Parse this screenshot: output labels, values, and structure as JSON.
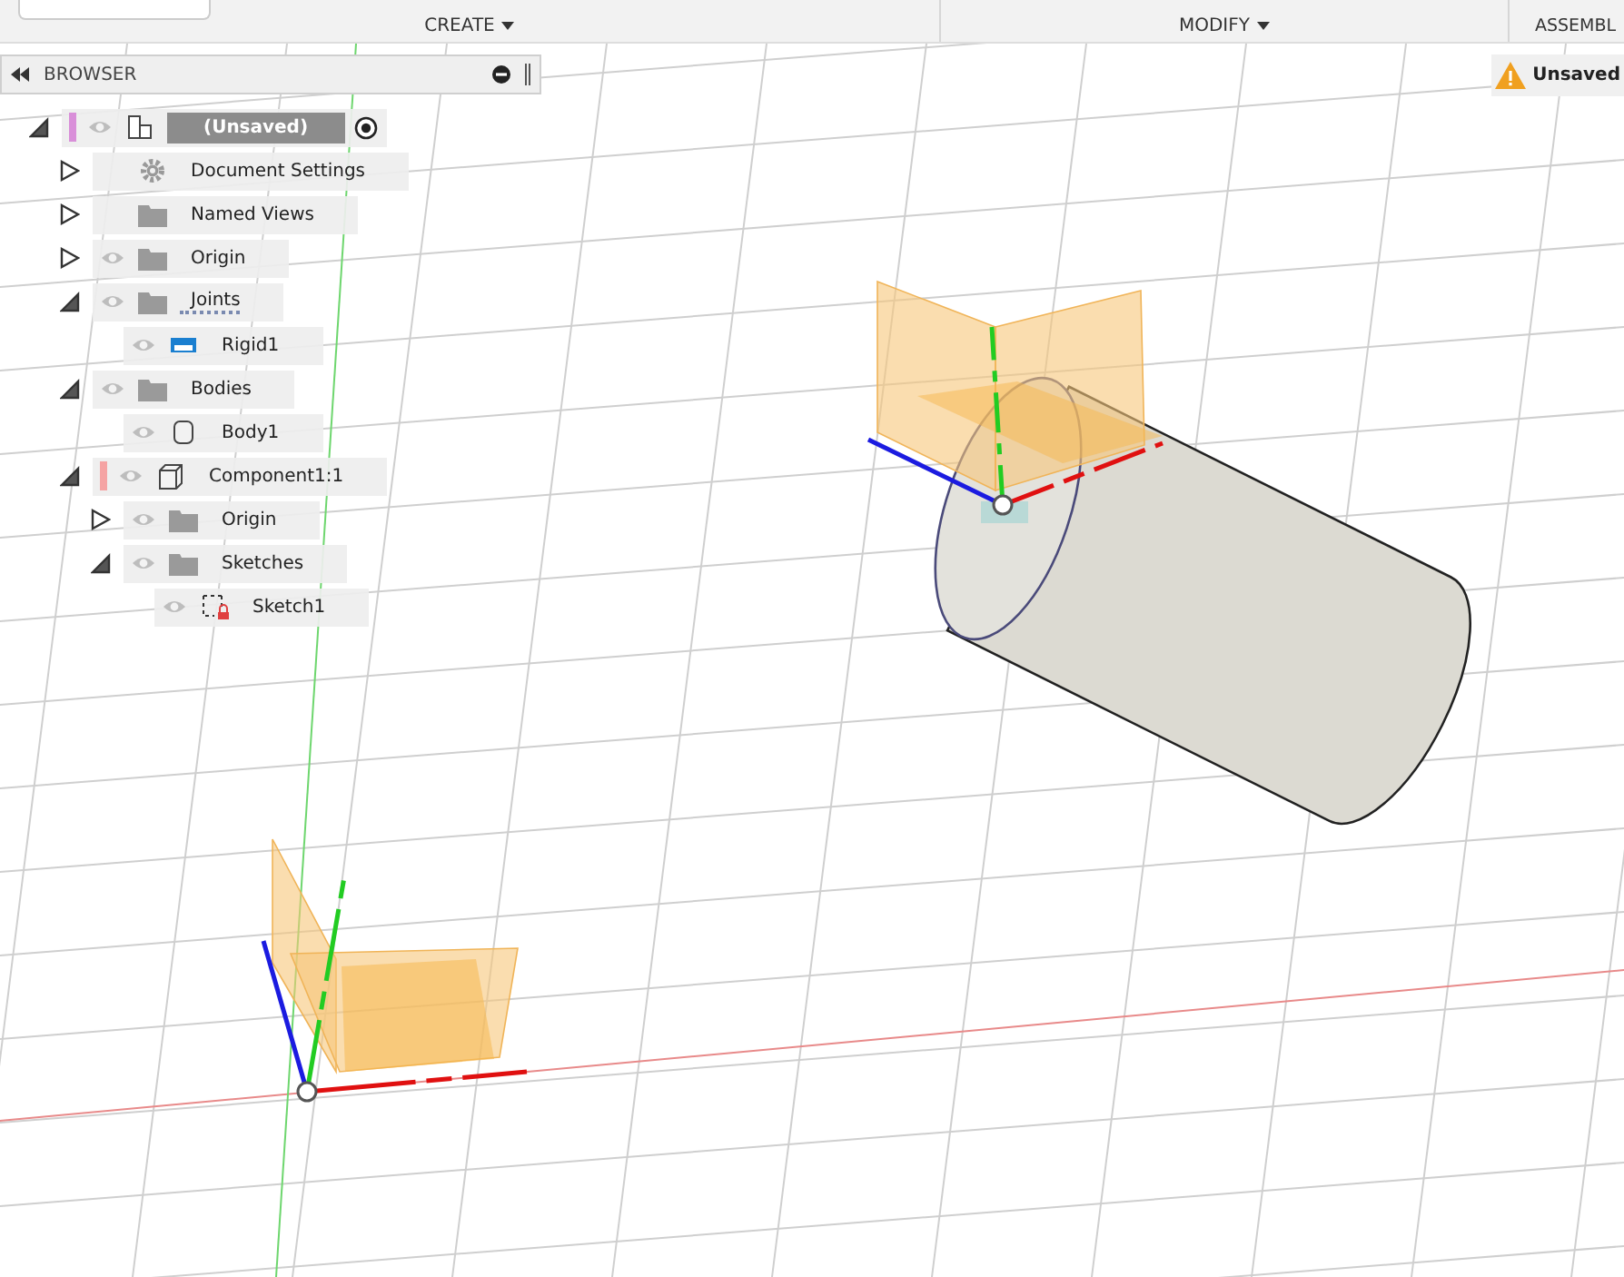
{
  "toolbar": {
    "groups": [
      {
        "label": "CREATE",
        "caret": true
      },
      {
        "label": "MODIFY",
        "caret": true
      },
      {
        "label": "ASSEMBL",
        "caret": false
      }
    ]
  },
  "warning": {
    "text": "Unsaved"
  },
  "browser": {
    "title": "BROWSER",
    "tree": [
      {
        "label": "(Unsaved)",
        "kind": "component",
        "eye": true,
        "expanded": true,
        "selected": true,
        "color": "#d98fd9",
        "active": true,
        "children": [
          {
            "label": "Document Settings",
            "kind": "settings",
            "eye": false,
            "expanded": false,
            "selected": false
          },
          {
            "label": "Named Views",
            "kind": "folder",
            "eye": false,
            "expanded": false,
            "selected": false
          },
          {
            "label": "Origin",
            "kind": "folder",
            "eye": true,
            "expanded": false,
            "selected": false
          },
          {
            "label": "Joints",
            "kind": "folder",
            "eye": true,
            "expanded": true,
            "selected": false,
            "children": [
              {
                "label": "Rigid1",
                "kind": "joint",
                "eye": true,
                "selected": false
              }
            ]
          },
          {
            "label": "Bodies",
            "kind": "folder",
            "eye": true,
            "expanded": true,
            "selected": false,
            "children": [
              {
                "label": "Body1",
                "kind": "body",
                "eye": true,
                "selected": false
              }
            ]
          },
          {
            "label": "Component1:1",
            "kind": "occurrence",
            "eye": true,
            "expanded": true,
            "selected": false,
            "color": "#f5a3a3",
            "children": [
              {
                "label": "Origin",
                "kind": "folder",
                "eye": true,
                "expanded": false,
                "selected": false
              },
              {
                "label": "Sketches",
                "kind": "folder",
                "eye": true,
                "expanded": true,
                "selected": false,
                "children": [
                  {
                    "label": "Sketch1",
                    "kind": "sketch",
                    "eye": true,
                    "selected": false
                  }
                ]
              }
            ]
          }
        ]
      }
    ]
  }
}
